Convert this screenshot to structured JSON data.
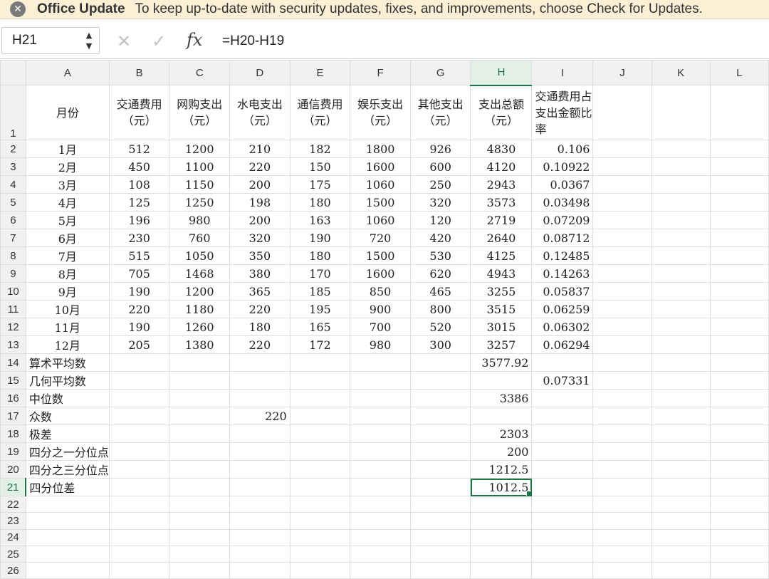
{
  "banner": {
    "title": "Office Update",
    "message": "To keep up-to-date with security updates, fixes, and improvements, choose Check for Updates."
  },
  "formula_bar": {
    "name_box": "H21",
    "fx_label": "fx",
    "formula": "=H20-H19"
  },
  "columns": [
    "A",
    "B",
    "C",
    "D",
    "E",
    "F",
    "G",
    "H",
    "I",
    "J",
    "K",
    "L"
  ],
  "selected_cell": "H21",
  "accent_color": "#1f7244",
  "header_row": [
    "月份",
    "交通费用（元）",
    "网购支出（元）",
    "水电支出（元）",
    "通信费用（元）",
    "娱乐支出（元）",
    "其他支出（元）",
    "支出总额（元）",
    "交通费用占支出金额比率",
    "",
    "",
    ""
  ],
  "rows": [
    [
      "1月",
      "512",
      "1200",
      "210",
      "182",
      "1800",
      "926",
      "4830",
      "0.106",
      "",
      "",
      ""
    ],
    [
      "2月",
      "450",
      "1100",
      "220",
      "150",
      "1600",
      "600",
      "4120",
      "0.10922",
      "",
      "",
      ""
    ],
    [
      "3月",
      "108",
      "1150",
      "200",
      "175",
      "1060",
      "250",
      "2943",
      "0.0367",
      "",
      "",
      ""
    ],
    [
      "4月",
      "125",
      "1250",
      "198",
      "180",
      "1500",
      "320",
      "3573",
      "0.03498",
      "",
      "",
      ""
    ],
    [
      "5月",
      "196",
      "980",
      "200",
      "163",
      "1060",
      "120",
      "2719",
      "0.07209",
      "",
      "",
      ""
    ],
    [
      "6月",
      "230",
      "760",
      "320",
      "190",
      "720",
      "420",
      "2640",
      "0.08712",
      "",
      "",
      ""
    ],
    [
      "7月",
      "515",
      "1050",
      "350",
      "180",
      "1500",
      "530",
      "4125",
      "0.12485",
      "",
      "",
      ""
    ],
    [
      "8月",
      "705",
      "1468",
      "380",
      "170",
      "1600",
      "620",
      "4943",
      "0.14263",
      "",
      "",
      ""
    ],
    [
      "9月",
      "190",
      "1200",
      "365",
      "185",
      "850",
      "465",
      "3255",
      "0.05837",
      "",
      "",
      ""
    ],
    [
      "10月",
      "220",
      "1180",
      "220",
      "195",
      "900",
      "800",
      "3515",
      "0.06259",
      "",
      "",
      ""
    ],
    [
      "11月",
      "190",
      "1260",
      "180",
      "165",
      "700",
      "520",
      "3015",
      "0.06302",
      "",
      "",
      ""
    ],
    [
      "12月",
      "205",
      "1380",
      "220",
      "172",
      "980",
      "300",
      "3257",
      "0.06294",
      "",
      "",
      ""
    ],
    [
      "算术平均数",
      "",
      "",
      "",
      "",
      "",
      "",
      "3577.92",
      "",
      "",
      "",
      ""
    ],
    [
      "几何平均数",
      "",
      "",
      "",
      "",
      "",
      "",
      "",
      "0.07331",
      "",
      "",
      ""
    ],
    [
      "中位数",
      "",
      "",
      "",
      "",
      "",
      "",
      "3386",
      "",
      "",
      "",
      ""
    ],
    [
      "众数",
      "",
      "",
      "220",
      "",
      "",
      "",
      "",
      "",
      "",
      "",
      ""
    ],
    [
      "极差",
      "",
      "",
      "",
      "",
      "",
      "",
      "2303",
      "",
      "",
      "",
      ""
    ],
    [
      "四分之一分位点",
      "",
      "",
      "",
      "",
      "",
      "",
      "200",
      "",
      "",
      "",
      ""
    ],
    [
      "四分之三分位点",
      "",
      "",
      "",
      "",
      "",
      "",
      "1212.5",
      "",
      "",
      "",
      ""
    ],
    [
      "四分位差",
      "",
      "",
      "",
      "",
      "",
      "",
      "1012.5",
      "",
      "",
      "",
      ""
    ],
    [
      "",
      "",
      "",
      "",
      "",
      "",
      "",
      "",
      "",
      "",
      "",
      ""
    ],
    [
      "",
      "",
      "",
      "",
      "",
      "",
      "",
      "",
      "",
      "",
      "",
      ""
    ],
    [
      "",
      "",
      "",
      "",
      "",
      "",
      "",
      "",
      "",
      "",
      "",
      ""
    ],
    [
      "",
      "",
      "",
      "",
      "",
      "",
      "",
      "",
      "",
      "",
      "",
      ""
    ],
    [
      "",
      "",
      "",
      "",
      "",
      "",
      "",
      "",
      "",
      "",
      "",
      ""
    ]
  ]
}
